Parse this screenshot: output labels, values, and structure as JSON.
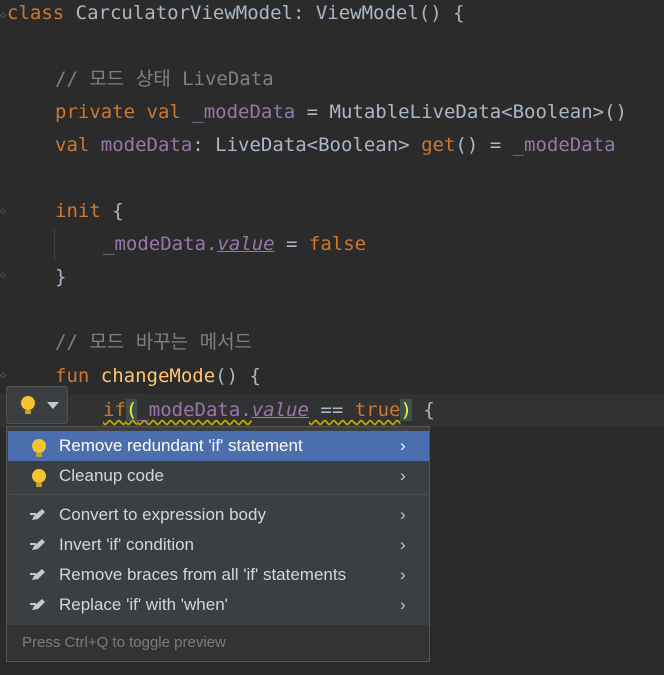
{
  "code": {
    "line1": {
      "kw": "class",
      "name": " CarculatorViewModel: ViewModel() {"
    },
    "line2": {
      "comment": "// 모드 상태 LiveData"
    },
    "line3": {
      "kw": "private val",
      "field": " _modeData",
      "rest": " = MutableLiveData<Boolean>()"
    },
    "line4": {
      "kw": "val",
      "field": " modeData",
      "mid": ": LiveData<Boolean> ",
      "getter": "get",
      "tail": "() = ",
      "field2": "_modeData"
    },
    "line5": {
      "kw": "init",
      "rest": " {"
    },
    "line6": {
      "field": "_modeData.",
      "prop": "value",
      "mid": " = ",
      "kw": "false"
    },
    "line7": {
      "rest": "}"
    },
    "line8": {
      "comment": "// 모드 바꾸는 메서드"
    },
    "line9": {
      "kw": "fun",
      "fn": " changeMode",
      "rest": "() {"
    },
    "line10": {
      "kw": "if",
      "open": "(",
      "field": "_modeData.",
      "prop": "value",
      "mid": " == ",
      "kw2": "true",
      "close": ")",
      "tail": " {"
    }
  },
  "intention_popup": {
    "items": [
      {
        "label": "Remove redundant 'if' statement",
        "icon": "bulb-icon",
        "selected": true
      },
      {
        "label": "Cleanup code",
        "icon": "bulb-icon"
      },
      {
        "label": "Convert to expression body",
        "icon": "pencil-icon"
      },
      {
        "label": "Invert 'if' condition",
        "icon": "pencil-icon"
      },
      {
        "label": "Remove braces from all 'if' statements",
        "icon": "pencil-icon"
      },
      {
        "label": "Replace 'if' with 'when'",
        "icon": "pencil-icon"
      }
    ],
    "arrow": "›",
    "footer": "Press Ctrl+Q to toggle preview"
  },
  "colors": {
    "selection": "#4b6eaf",
    "keyword": "#cc7832",
    "field": "#9876aa",
    "function": "#ffc66d",
    "comment": "#808080"
  }
}
